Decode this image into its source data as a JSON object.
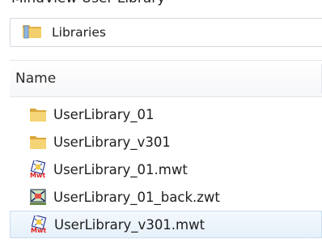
{
  "top_caption": "MindView User Library",
  "address_bar": {
    "icon": "libraries-folder-icon",
    "label": "Libraries"
  },
  "file_list": {
    "column_header": "Name",
    "items": [
      {
        "name": "UserLibrary_01",
        "icon": "folder-icon",
        "selected": false
      },
      {
        "name": "UserLibrary_v301",
        "icon": "folder-icon",
        "selected": false
      },
      {
        "name": "UserLibrary_01.mwt",
        "icon": "mwt-file-icon",
        "selected": false
      },
      {
        "name": "UserLibrary_01_back.zwt",
        "icon": "zwt-file-icon",
        "selected": false
      },
      {
        "name": "UserLibrary_v301.mwt",
        "icon": "mwt-file-icon",
        "selected": true
      }
    ]
  }
}
